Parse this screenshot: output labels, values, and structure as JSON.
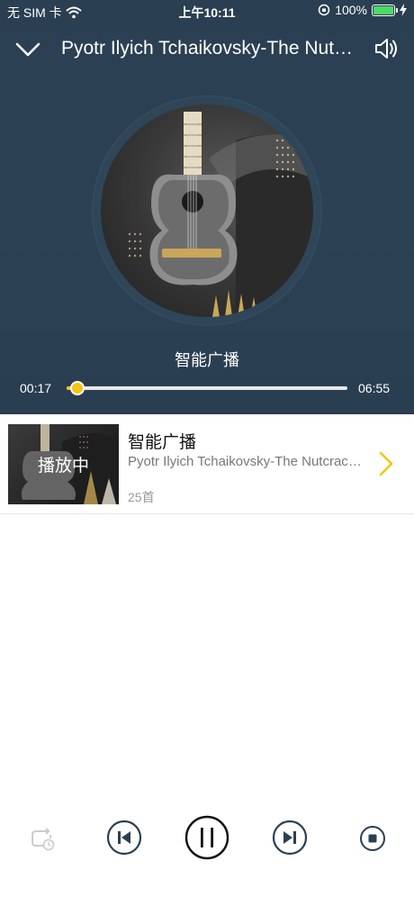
{
  "status_bar": {
    "carrier": "无 SIM 卡",
    "time": "上午10:11",
    "battery_percent": "100%",
    "battery_level": 1.0
  },
  "header": {
    "title": "Pyotr Ilyich Tchaikovsky-The Nutcracker",
    "back_icon": "chevron-down-icon",
    "volume_icon": "speaker-icon"
  },
  "player": {
    "station_name": "智能广播",
    "current_time": "00:17",
    "total_time": "06:55",
    "progress": 0.04
  },
  "playlist_item": {
    "title": "智能广播",
    "subtitle": "Pyotr Ilyich Tchaikovsky-The Nutcracker",
    "count": "25首",
    "playing_label": "播放中"
  },
  "controls": {
    "icons": [
      "timer-icon",
      "previous-icon",
      "pause-icon",
      "next-icon",
      "stop-icon"
    ]
  },
  "colors": {
    "accent": "#f5c518",
    "header_bg": "#2c4154",
    "control": "#2b3f52"
  }
}
